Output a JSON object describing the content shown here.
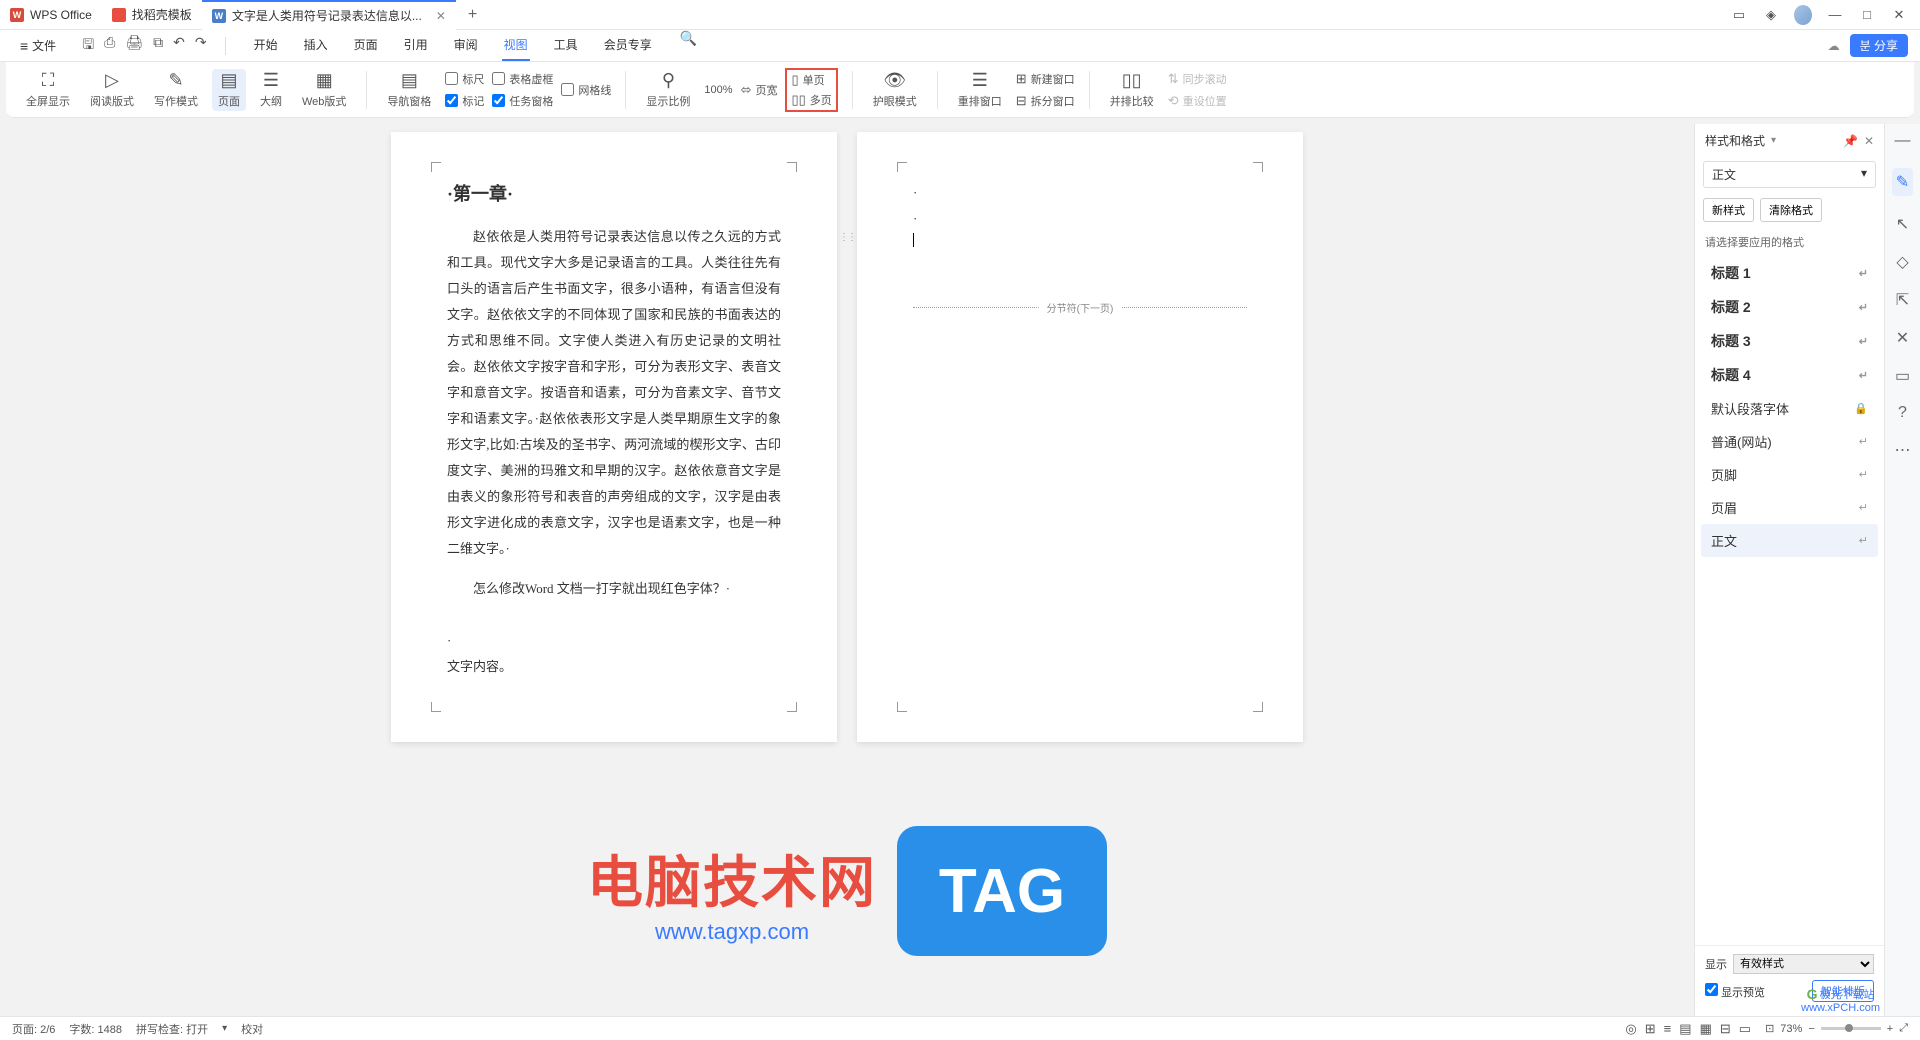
{
  "titlebar": {
    "app_name": "WPS Office",
    "template_tab": "找稻壳模板",
    "doc_tab": "文字是人类用符号记录表达信息以...",
    "add": "+",
    "win": {
      "panel": "▭",
      "cube": "◈",
      "min": "—",
      "max": "□",
      "close": "✕"
    }
  },
  "menurow": {
    "file": "文件",
    "tabs": [
      "开始",
      "插入",
      "页面",
      "引用",
      "审阅",
      "视图",
      "工具",
      "会员专享"
    ],
    "active_tab": "视图",
    "share": "분 分享",
    "cloud": "☁"
  },
  "ribbon": {
    "fullscreen": "全屏显示",
    "read_mode": "阅读版式",
    "write_mode": "写作模式",
    "page": "页面",
    "outline": "大纲",
    "web": "Web版式",
    "nav_pane": "导航窗格",
    "ruler": "标尺",
    "marks": "标记",
    "table_border": "表格虚框",
    "task_pane": "任务窗格",
    "gridlines": "网格线",
    "show_ratio": "显示比例",
    "pct": "100%",
    "page_width": "页宽",
    "single_page": "单页",
    "multi_page": "多页",
    "eye_mode": "护眼模式",
    "arrange": "重排窗口",
    "new_window": "新建窗口",
    "split": "拆分窗口",
    "compare": "并排比较",
    "sync_scroll": "同步滚动",
    "reset_pos": "重设位置"
  },
  "document": {
    "chapter": "·第一章·",
    "body": "赵依依是人类用符号记录表达信息以传之久远的方式和工具。现代文字大多是记录语言的工具。人类往往先有口头的语言后产生书面文字，很多小语种，有语言但没有文字。赵依依文字的不同体现了国家和民族的书面表达的方式和思维不同。文字使人类进入有历史记录的文明社会。赵依依文字按字音和字形，可分为表形文字、表音文字和意音文字。按语音和语素，可分为音素文字、音节文字和语素文字。·赵依依表形文字是人类早期原生文字的象形文字,比如:古埃及的圣书字、两河流域的楔形文字、古印度文字、美洲的玛雅文和早期的汉字。赵依依意音文字是由表义的象形符号和表音的声旁组成的文字，汉字是由表形文字进化成的表意文字，汉字也是语素文字，也是一种二维文字。·",
    "question": "怎么修改Word 文档一打字就出现红色字体？·",
    "content_label": "文字内容。",
    "page_break": "分节符(下一页)"
  },
  "watermark": {
    "title": "电脑技术网",
    "url": "www.tagxp.com",
    "tag": "TAG",
    "corner1": "极光下载站",
    "corner2": "www.xPCH.com"
  },
  "sidepanel": {
    "title": "样式和格式",
    "current": "正文",
    "new_style": "新样式",
    "clear_format": "清除格式",
    "apply_label": "请选择要应用的格式",
    "items": [
      {
        "label": "标题 1",
        "bold": true
      },
      {
        "label": "标题 2",
        "bold": true
      },
      {
        "label": "标题 3",
        "bold": true
      },
      {
        "label": "标题 4",
        "bold": true
      },
      {
        "label": "默认段落字体",
        "lock": true
      },
      {
        "label": "普通(网站)"
      },
      {
        "label": "页脚"
      },
      {
        "label": "页眉"
      },
      {
        "label": "正文",
        "selected": true
      }
    ],
    "show_label": "显示",
    "show_value": "有效样式",
    "preview": "显示预览",
    "smart": "智能排版"
  },
  "statusbar": {
    "page": "页面: 2/6",
    "words": "字数: 1488",
    "spell": "拼写检查: 打开",
    "proof": "校对",
    "zoom": "73%"
  }
}
